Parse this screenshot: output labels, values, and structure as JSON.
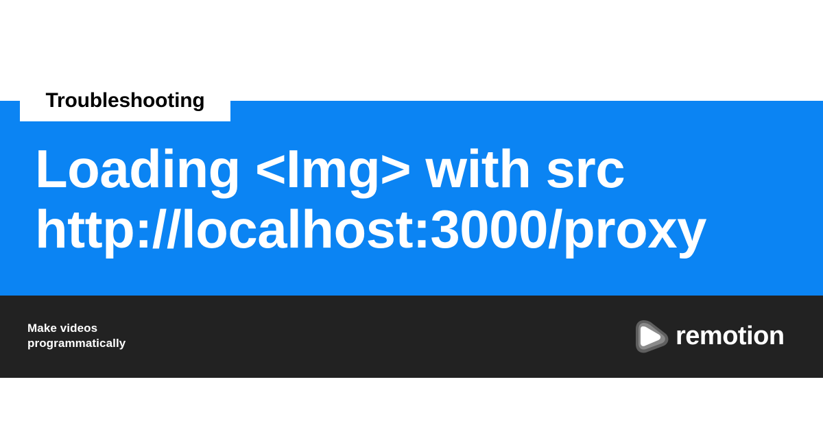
{
  "tag": {
    "label": "Troubleshooting"
  },
  "headline": {
    "line1": "Loading <Img> with src",
    "line2": "http://localhost:3000/proxy"
  },
  "footer": {
    "tagline_line1": "Make videos",
    "tagline_line2": "programmatically"
  },
  "brand": {
    "name": "remotion",
    "icon": "remotion-play-logo-icon"
  },
  "colors": {
    "background": "#ffffff",
    "hero": "#0b84f3",
    "footer": "#222222",
    "text_on_dark": "#ffffff",
    "text_on_light": "#000000"
  }
}
